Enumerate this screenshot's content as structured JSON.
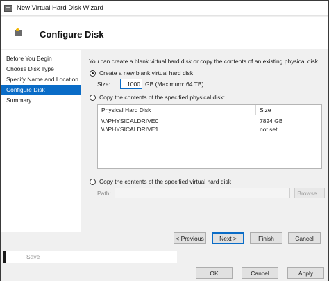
{
  "window": {
    "title": "New Virtual Hard Disk Wizard",
    "icon": "virtual-disk-icon"
  },
  "header": {
    "title": "Configure Disk",
    "icon": "disk-config-icon"
  },
  "nav": {
    "items": [
      {
        "label": "Before You Begin",
        "active": false
      },
      {
        "label": "Choose Disk Type",
        "active": false
      },
      {
        "label": "Specify Name and Location",
        "active": false
      },
      {
        "label": "Configure Disk",
        "active": true
      },
      {
        "label": "Summary",
        "active": false
      }
    ]
  },
  "main": {
    "intro": "You can create a blank virtual hard disk or copy the contents of an existing physical disk.",
    "option_blank": {
      "label": "Create a new blank virtual hard disk",
      "selected": true
    },
    "size": {
      "label": "Size:",
      "value": "1000",
      "unit": "GB (Maximum: 64 TB)"
    },
    "option_physical": {
      "label": "Copy the contents of the specified physical disk:",
      "selected": false
    },
    "disk_table": {
      "columns": [
        "Physical Hard Disk",
        "Size"
      ],
      "rows": [
        {
          "disk": "\\\\.\\PHYSICALDRIVE0",
          "size": "7824 GB"
        },
        {
          "disk": "\\\\.\\PHYSICALDRIVE1",
          "size": "not set"
        }
      ]
    },
    "option_virtual": {
      "label": "Copy the contents of the specified virtual hard disk",
      "selected": false
    },
    "path": {
      "label": "Path:",
      "value": ""
    },
    "browse_label": "Browse..."
  },
  "wizard_buttons": {
    "previous": "< Previous",
    "next": "Next >",
    "finish": "Finish",
    "cancel": "Cancel"
  },
  "bottom": {
    "save_label": "Save",
    "ok": "OK",
    "cancel": "Cancel",
    "apply": "Apply"
  },
  "colors": {
    "accent": "#0a6cc7",
    "background": "#f0f0f0"
  }
}
